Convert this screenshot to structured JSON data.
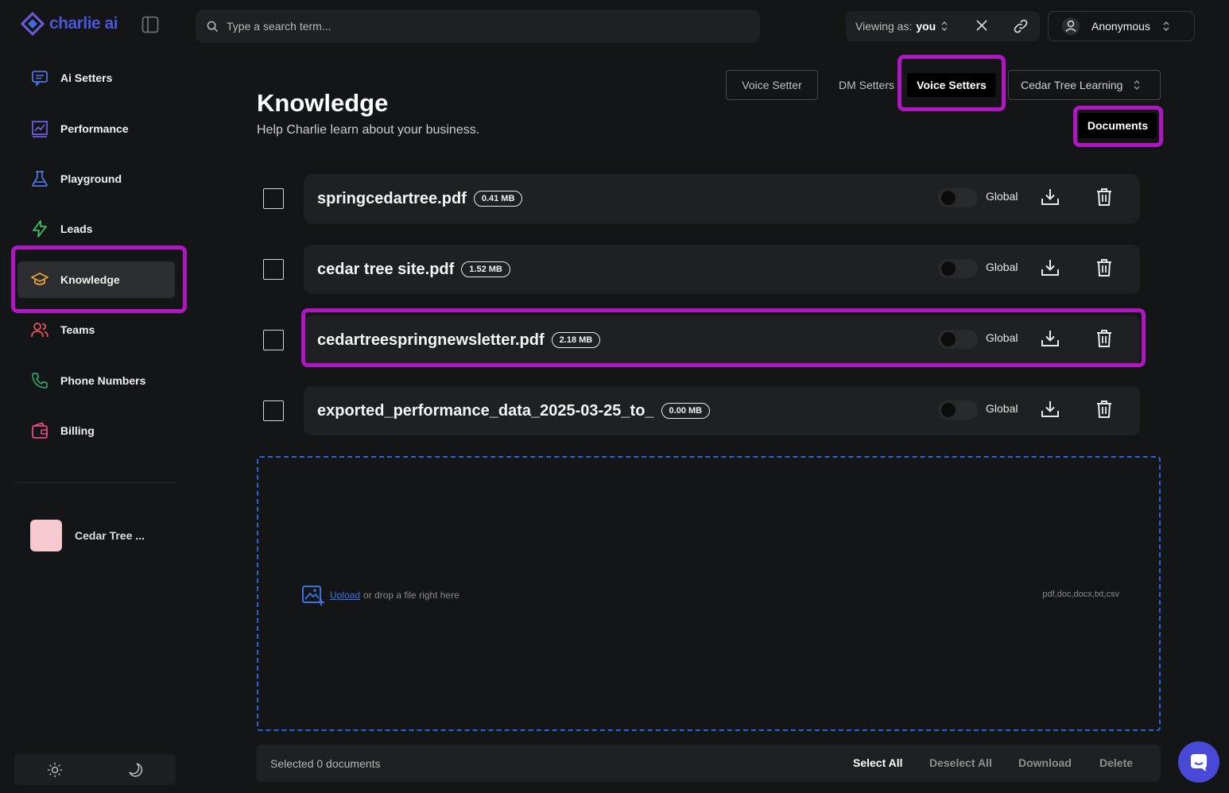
{
  "brand": {
    "name": "charlie ai"
  },
  "search": {
    "placeholder": "Type a search term..."
  },
  "viewing": {
    "label": "Viewing as:",
    "value": "you"
  },
  "user": {
    "name": "Anonymous"
  },
  "sidebar": {
    "items": [
      {
        "label": "Ai Setters",
        "icon": "chat-icon"
      },
      {
        "label": "Performance",
        "icon": "chart-icon"
      },
      {
        "label": "Playground",
        "icon": "flask-icon"
      },
      {
        "label": "Leads",
        "icon": "bolt-icon"
      },
      {
        "label": "Knowledge",
        "icon": "graduation-cap-icon",
        "active": true
      },
      {
        "label": "Teams",
        "icon": "users-icon"
      },
      {
        "label": "Phone Numbers",
        "icon": "phone-icon"
      },
      {
        "label": "Billing",
        "icon": "wallet-icon"
      }
    ],
    "org": {
      "name": "Cedar Tree ..."
    }
  },
  "header": {
    "title": "Knowledge",
    "subtitle": "Help Charlie learn about your business."
  },
  "tabs": {
    "voice_setter": "Voice Setter",
    "dm_setters": "DM Setters",
    "voice_setters": "Voice Setters",
    "team_select": "Cedar Tree Learning",
    "documents": "Documents"
  },
  "documents": [
    {
      "name": "springcedartree.pdf",
      "size": "0.41 MB",
      "scope": "Global"
    },
    {
      "name": "cedar tree site.pdf",
      "size": "1.52 MB",
      "scope": "Global"
    },
    {
      "name": "cedartreespringnewsletter.pdf",
      "size": "2.18 MB",
      "scope": "Global"
    },
    {
      "name": "exported_performance_data_2025-03-25_to_",
      "size": "0.00 MB",
      "scope": "Global"
    }
  ],
  "upload": {
    "link": "Upload",
    "text": "or drop a file right here",
    "types": "pdf,doc,docx,txt,csv"
  },
  "bottom_bar": {
    "selected": "Selected 0 documents",
    "select_all": "Select All",
    "deselect_all": "Deselect All",
    "download": "Download",
    "delete": "Delete"
  },
  "colors": {
    "accent": "#4a57d8",
    "highlight": "#b016c2",
    "upload_border": "#2b66d9",
    "background": "#131517"
  }
}
